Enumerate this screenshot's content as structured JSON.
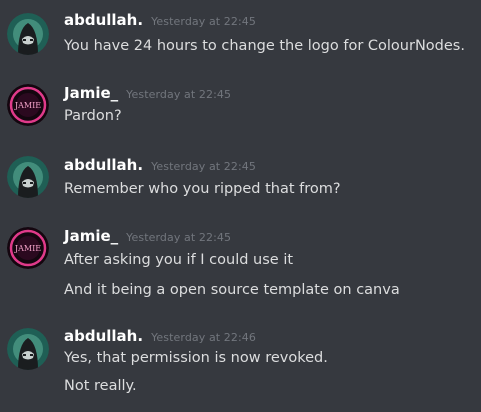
{
  "messages": [
    {
      "username": "abdullah.",
      "timestamp": "Yesterday at 22:45",
      "avatar": "dark-hooded-figure-avatar",
      "lines": [
        "You have 24 hours to change the logo for ColourNodes."
      ]
    },
    {
      "username": "Jamie_",
      "timestamp": "Yesterday at 22:45",
      "avatar": "jamie-neon-avatar",
      "avatar_text": "JAMIE",
      "lines": [
        "Pardon?"
      ]
    },
    {
      "username": "abdullah.",
      "timestamp": "Yesterday at 22:45",
      "avatar": "dark-hooded-figure-avatar",
      "lines": [
        "Remember who you ripped that from?"
      ]
    },
    {
      "username": "Jamie_",
      "timestamp": "Yesterday at 22:45",
      "avatar": "jamie-neon-avatar",
      "avatar_text": "JAMIE",
      "lines": [
        "After asking you if I could use it",
        "And it being a open source template on canva"
      ]
    },
    {
      "username": "abdullah.",
      "timestamp": "Yesterday at 22:46",
      "avatar": "dark-hooded-figure-avatar",
      "lines": [
        "Yes, that permission is now revoked.",
        "Not really."
      ]
    }
  ],
  "colors": {
    "background": "#36393f",
    "username": "#ffffff",
    "timestamp": "#72767d",
    "message_text": "#dcddde",
    "avatar_abdullah_bg": "#1f5f55",
    "avatar_jamie_neon": "#e03a8a"
  }
}
